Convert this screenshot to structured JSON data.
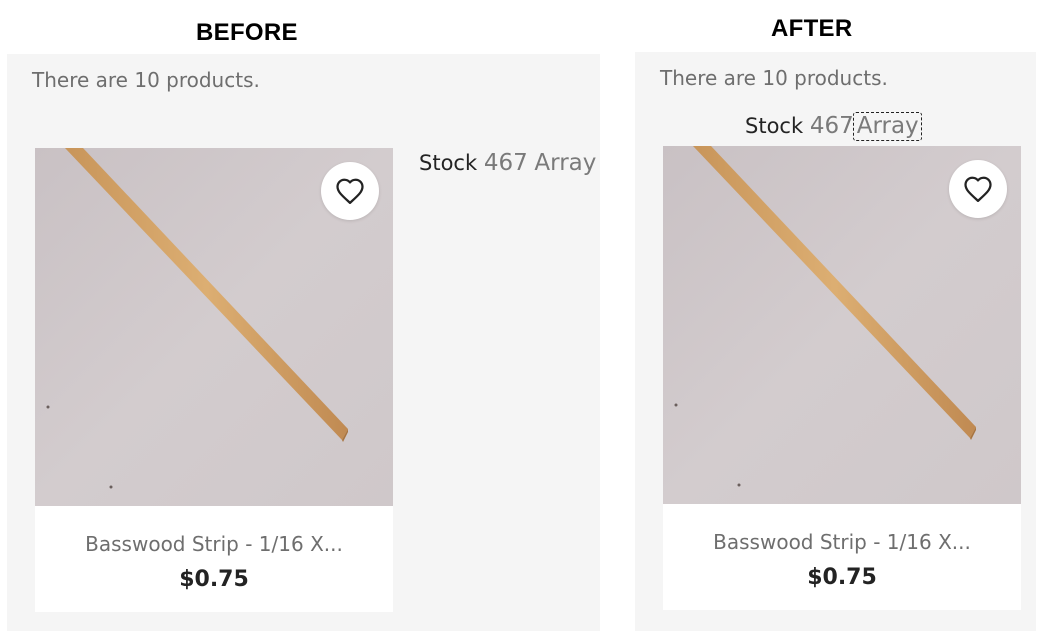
{
  "labels": {
    "before": "BEFORE",
    "after": "AFTER"
  },
  "listing": {
    "product_count_text": "There are 10 products."
  },
  "stock": {
    "label": "Stock",
    "quantity": "467",
    "value": "Array"
  },
  "product": {
    "name": "Basswood Strip - 1/16 X...",
    "price": "$0.75",
    "wishlist_icon": "heart-outline-icon"
  },
  "colors": {
    "panel_bg": "#f5f5f5",
    "card_bg": "#ffffff",
    "muted_text": "#6e6e6e",
    "dark_text": "#232323",
    "wood": "#d4a569"
  }
}
